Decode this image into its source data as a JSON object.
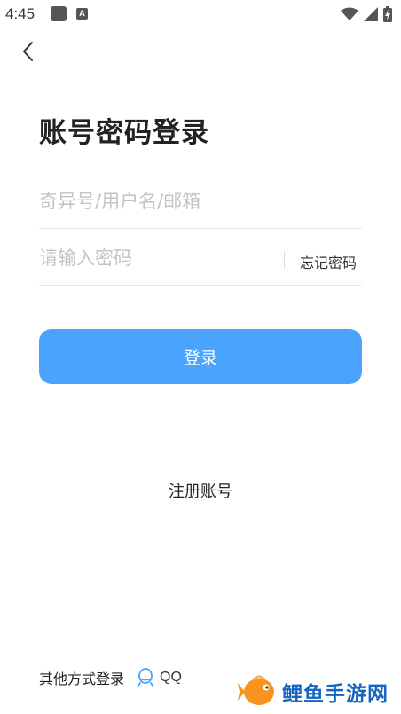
{
  "status_bar": {
    "time": "4:45",
    "a_badge": "A"
  },
  "page": {
    "title": "账号密码登录"
  },
  "form": {
    "username_placeholder": "奇异号/用户名/邮箱",
    "password_placeholder": "请输入密码",
    "forgot_password": "忘记密码",
    "login_button": "登录"
  },
  "register_link": "注册账号",
  "other_login": {
    "label": "其他方式登录",
    "qq": "QQ"
  },
  "watermark": {
    "text": "鲤鱼手游网"
  },
  "colors": {
    "accent": "#4aa3ff",
    "placeholder": "#c3c3c3",
    "watermark_blue": "#1565c0",
    "watermark_orange": "#f7931e"
  }
}
